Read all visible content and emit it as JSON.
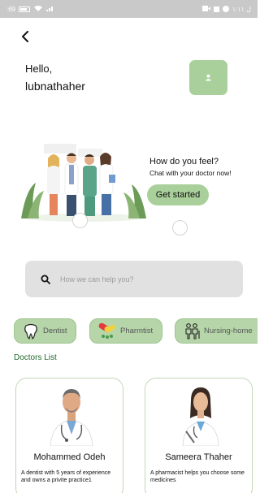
{
  "status_bar": {
    "left_text": "‎:69",
    "right_text": "‎ل ١:١١"
  },
  "header": {
    "greeting": "Hello,",
    "username": "lubnathaher"
  },
  "banner": {
    "title": "How do you feel?",
    "subtitle": "Chat with your doctor now!",
    "cta_label": "Get started"
  },
  "search": {
    "placeholder": "How we can help you?"
  },
  "categories": [
    {
      "label": "Dentist",
      "icon": "tooth-icon"
    },
    {
      "label": "Pharmtist",
      "icon": "pills-icon"
    },
    {
      "label": "Nursing-home",
      "icon": "elderly-icon"
    }
  ],
  "doctors_section": {
    "title": "Doctors List"
  },
  "doctors": [
    {
      "name": "Mohammed Odeh",
      "description": "A dentist with 5 years of experience and owns a privite practice1"
    },
    {
      "name": "Sameera Thaher",
      "description": "A pharmacist helps you choose some medicines"
    }
  ],
  "colors": {
    "accent_green": "#a9d09a",
    "chip_green": "#b6d6a9",
    "title_green": "#1f6b2a",
    "search_gray": "#e1e1e1"
  }
}
